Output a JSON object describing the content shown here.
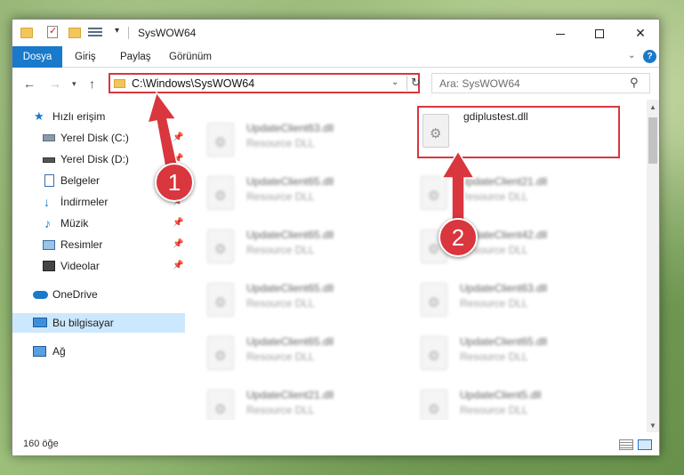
{
  "window": {
    "title": "SysWOW64",
    "controls": {
      "minimize": "",
      "maximize": "",
      "close": "✕"
    }
  },
  "ribbon": {
    "tabs": [
      "Dosya",
      "Giriş",
      "Paylaş",
      "Görünüm"
    ],
    "help": "?"
  },
  "address": {
    "path": "C:\\Windows\\SysWOW64",
    "search_placeholder": "Ara: SysWOW64"
  },
  "nav": {
    "items": [
      {
        "label": "Hızlı erişim"
      },
      {
        "label": "Yerel Disk (C:)"
      },
      {
        "label": "Yerel Disk (D:)"
      },
      {
        "label": "Belgeler"
      },
      {
        "label": "İndirmeler"
      },
      {
        "label": "Müzik"
      },
      {
        "label": "Resimler"
      },
      {
        "label": "Videolar"
      },
      {
        "label": "OneDrive"
      },
      {
        "label": "Bu bilgisayar"
      },
      {
        "label": "Ağ"
      }
    ],
    "selected": "Bu bilgisayar"
  },
  "files": [
    {
      "name": "UpdateClient63.dll",
      "type": "Resource DLL"
    },
    {
      "name": "gdiplustest.dll",
      "type": ""
    },
    {
      "name": "UpdateClient65.dll",
      "type": "Resource DLL"
    },
    {
      "name": "UpdateClient21.dll",
      "type": "Resource DLL"
    },
    {
      "name": "UpdateClient65.dll",
      "type": "Resource DLL"
    },
    {
      "name": "UpdateClient42.dll",
      "type": "Resource DLL"
    },
    {
      "name": "UpdateClient65.dll",
      "type": "Resource DLL"
    },
    {
      "name": "UpdateClient63.dll",
      "type": "Resource DLL"
    },
    {
      "name": "UpdateClient65.dll",
      "type": "Resource DLL"
    },
    {
      "name": "UpdateClient65.dll",
      "type": "Resource DLL"
    },
    {
      "name": "UpdateClient21.dll",
      "type": "Resource DLL"
    },
    {
      "name": "UpdateClient5.dll",
      "type": "Resource DLL"
    }
  ],
  "status": {
    "item_count": "160 öğe"
  },
  "annotations": {
    "step1": "1",
    "step2": "2",
    "color": "#d9363e"
  },
  "colors": {
    "accent": "#1979ca",
    "highlight": "#d9363e",
    "selected_bg": "#cce8ff"
  }
}
